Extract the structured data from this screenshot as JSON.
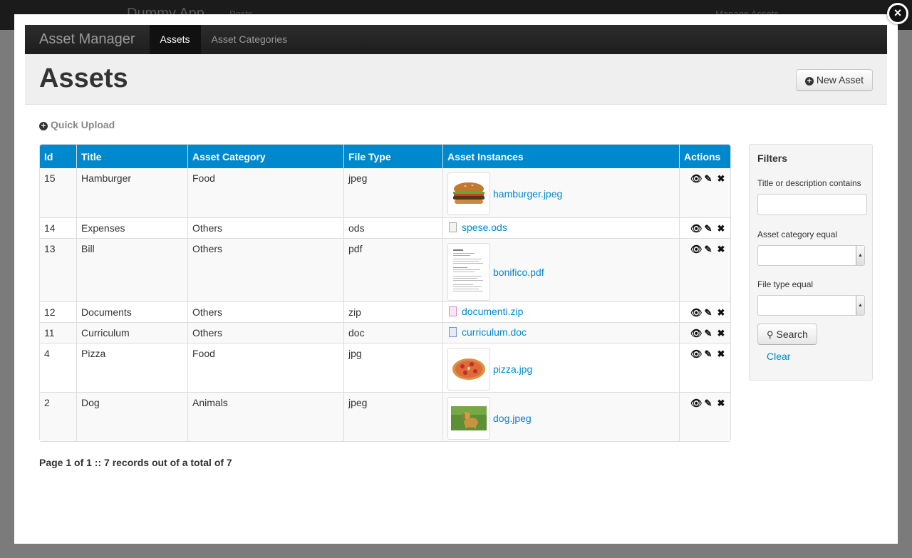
{
  "background": {
    "brand": "Dummy App",
    "nav": [
      "Posts",
      "Manage Assets"
    ]
  },
  "close_label": "×",
  "navbar": {
    "brand": "Asset Manager",
    "tabs": [
      {
        "label": "Assets",
        "active": true
      },
      {
        "label": "Asset Categories",
        "active": false
      }
    ]
  },
  "header": {
    "title": "Assets",
    "new_button": "New Asset"
  },
  "quick_upload": "Quick Upload",
  "table": {
    "columns": [
      "Id",
      "Title",
      "Asset Category",
      "File Type",
      "Asset Instances",
      "Actions"
    ],
    "rows": [
      {
        "id": "15",
        "title": "Hamburger",
        "category": "Food",
        "type": "jpeg",
        "file": "hamburger.jpeg",
        "thumb": "hamburger"
      },
      {
        "id": "14",
        "title": "Expenses",
        "category": "Others",
        "type": "ods",
        "file": "spese.ods",
        "thumb": "ods-icon"
      },
      {
        "id": "13",
        "title": "Bill",
        "category": "Others",
        "type": "pdf",
        "file": "bonifico.pdf",
        "thumb": "pdf-preview"
      },
      {
        "id": "12",
        "title": "Documents",
        "category": "Others",
        "type": "zip",
        "file": "documenti.zip",
        "thumb": "zip-icon"
      },
      {
        "id": "11",
        "title": "Curriculum",
        "category": "Others",
        "type": "doc",
        "file": "curriculum.doc",
        "thumb": "doc-icon"
      },
      {
        "id": "4",
        "title": "Pizza",
        "category": "Food",
        "type": "jpg",
        "file": "pizza.jpg",
        "thumb": "pizza"
      },
      {
        "id": "2",
        "title": "Dog",
        "category": "Animals",
        "type": "jpeg",
        "file": "dog.jpeg",
        "thumb": "dog"
      }
    ],
    "action_icons": [
      "eye-icon",
      "pencil-icon",
      "delete-icon"
    ]
  },
  "pagination": "Page 1 of 1 :: 7 records out of a total of 7",
  "filters": {
    "title": "Filters",
    "title_label": "Title or description contains",
    "title_value": "",
    "category_label": "Asset category equal",
    "category_value": "",
    "filetype_label": "File type equal",
    "filetype_value": "",
    "search_button": "Search",
    "clear_link": "Clear"
  },
  "colors": {
    "table_header": "#0088cc",
    "link": "#0088cc",
    "navbar": "#222222"
  }
}
